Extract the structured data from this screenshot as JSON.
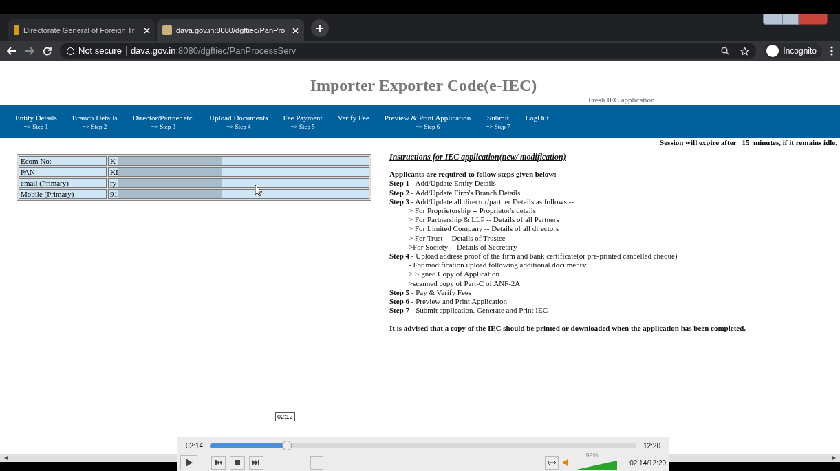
{
  "browser": {
    "tabs": [
      {
        "title": "Directorate General of Foreign Tr",
        "selected": false
      },
      {
        "title": "dava.gov.in:8080/dgftiec/PanPro",
        "selected": true
      }
    ],
    "security": "Not secure",
    "url_host": "dava.gov.in",
    "url_path": ":8080/dgftiec/PanProcessServ",
    "profile": "Incognito"
  },
  "page": {
    "title": "Importer Exporter Code(e-IEC)",
    "subtitle": "Fresh IEC application",
    "nav": [
      {
        "label": "Entity Details",
        "step": "=> Step 1"
      },
      {
        "label": "Branch Details",
        "step": "=> Step 2"
      },
      {
        "label": "Director/Partner etc.",
        "step": "=> Step 3"
      },
      {
        "label": "Upload Documents",
        "step": "=> Step 4"
      },
      {
        "label": "Fee Payment",
        "step": "=> Step 5"
      },
      {
        "label": "Verify Fee"
      },
      {
        "label": "Preview & Print Application",
        "step": "=> Step 6"
      },
      {
        "label": "Submit",
        "step": "=> Step 7"
      },
      {
        "label": "LogOut"
      }
    ],
    "session_notice": "Session will expire after   15  minutes, if it remains idle.",
    "details": [
      {
        "label": "Ecom No:",
        "value": "K"
      },
      {
        "label": "PAN",
        "value": "KI"
      },
      {
        "label": "email (Primary)",
        "value": "ry"
      },
      {
        "label": "Mobile (Primary)",
        "value": "91"
      }
    ],
    "instructions_title": "Instructions for IEC application(new/ modification)",
    "instructions_intro": "Applicants are required to follow steps given below:",
    "instructions": [
      {
        "kind": "step",
        "text": "**Step 1** - Add/Update Entity Details"
      },
      {
        "kind": "step",
        "text": "**Step 2** - Add/Update Firm's Branch Details"
      },
      {
        "kind": "step",
        "text": "**Step 3** - Add/Update all director/partner Details as follows --"
      },
      {
        "kind": "sub",
        "text": "> For Proprietorship -- Proprietor's details"
      },
      {
        "kind": "sub",
        "text": "> For Partnership & LLP -- Details of all Partners"
      },
      {
        "kind": "sub",
        "text": "> For Limited Company -- Details of all directors"
      },
      {
        "kind": "sub",
        "text": "> For Trust -- Details of Trustee"
      },
      {
        "kind": "sub",
        "text": ">For Society -- Details of Secretary"
      },
      {
        "kind": "step",
        "text": "**Step 4** - Upload address proof of the firm and bank certificate(or pre-printed cancelled cheque)"
      },
      {
        "kind": "sub",
        "text": "- For modification upload following additional documents:"
      },
      {
        "kind": "sub",
        "text": "> Signed Copy of Application"
      },
      {
        "kind": "sub",
        "text": ">scanned copy of Part-C of ANF-2A"
      },
      {
        "kind": "step",
        "text": "**Step 5** - Pay & Verify Fees"
      },
      {
        "kind": "step",
        "text": "**Step 6** - Preview and Print Application"
      },
      {
        "kind": "step",
        "text": "**Step 7** - Submit application. Generate and Print IEC"
      }
    ],
    "advice": "It is advised that a copy of the IEC should be printed or downloaded when the application has been completed."
  },
  "player": {
    "tooltip": "02:12",
    "elapsed": "02:14",
    "duration": "12:20",
    "level": 0.18,
    "volume_label": "99%",
    "volume": {
      "level": 0.99
    },
    "clock": "02:14/12:20"
  }
}
